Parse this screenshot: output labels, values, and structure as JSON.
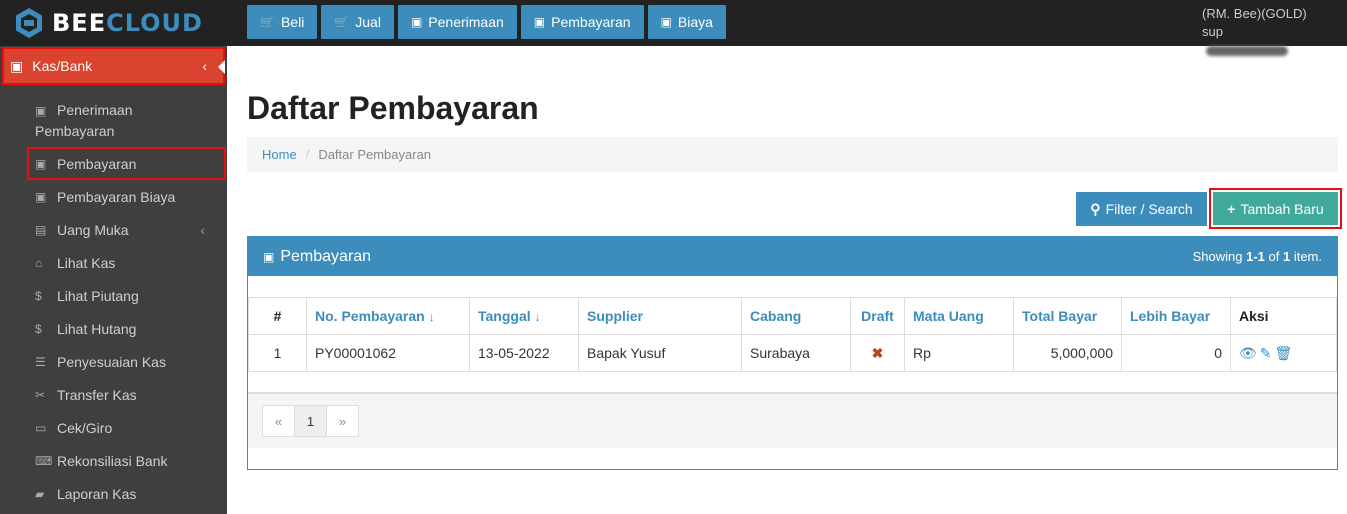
{
  "brand": {
    "part1": "BEE",
    "part2": "CLOUD"
  },
  "topnav": [
    {
      "label": "Beli",
      "icon": "cart-icon"
    },
    {
      "label": "Jual",
      "icon": "cart-icon"
    },
    {
      "label": "Penerimaan",
      "icon": "money-icon"
    },
    {
      "label": "Pembayaran",
      "icon": "money-icon"
    },
    {
      "label": "Biaya",
      "icon": "money-icon"
    }
  ],
  "user": {
    "company": "(RM. Bee)(GOLD)",
    "prefix": "sup"
  },
  "sidebar": {
    "header": "Kas/Bank",
    "items": [
      {
        "label": "Penerimaan Pembayaran"
      },
      {
        "label": "Pembayaran"
      },
      {
        "label": "Pembayaran Biaya"
      },
      {
        "label": "Uang Muka"
      },
      {
        "label": "Lihat Kas"
      },
      {
        "label": "Lihat Piutang"
      },
      {
        "label": "Lihat Hutang"
      },
      {
        "label": "Penyesuaian Kas"
      },
      {
        "label": "Transfer Kas"
      },
      {
        "label": "Cek/Giro"
      },
      {
        "label": "Rekonsiliasi Bank"
      },
      {
        "label": "Laporan Kas"
      }
    ]
  },
  "page": {
    "title": "Daftar Pembayaran"
  },
  "breadcrumb": {
    "home": "Home",
    "current": "Daftar Pembayaran"
  },
  "actions": {
    "filter": "Filter / Search",
    "add": "Tambah Baru"
  },
  "panel": {
    "title": "Pembayaran",
    "summary_prefix": "Showing ",
    "summary_range": "1-1",
    "summary_mid": " of ",
    "summary_total": "1",
    "summary_suffix": " item."
  },
  "table": {
    "headers": [
      "#",
      "No. Pembayaran",
      "Tanggal",
      "Supplier",
      "Cabang",
      "Draft",
      "Mata Uang",
      "Total Bayar",
      "Lebih Bayar",
      "Aksi"
    ],
    "rows": [
      {
        "no": "1",
        "nomor": "PY00001062",
        "tanggal": "13-05-2022",
        "supplier": "Bapak Yusuf",
        "cabang": "Surabaya",
        "draft": "✖",
        "mata_uang": "Rp",
        "total": "5,000,000",
        "lebih": "0"
      }
    ]
  },
  "pager": {
    "prev": "«",
    "page": "1",
    "next": "»"
  }
}
